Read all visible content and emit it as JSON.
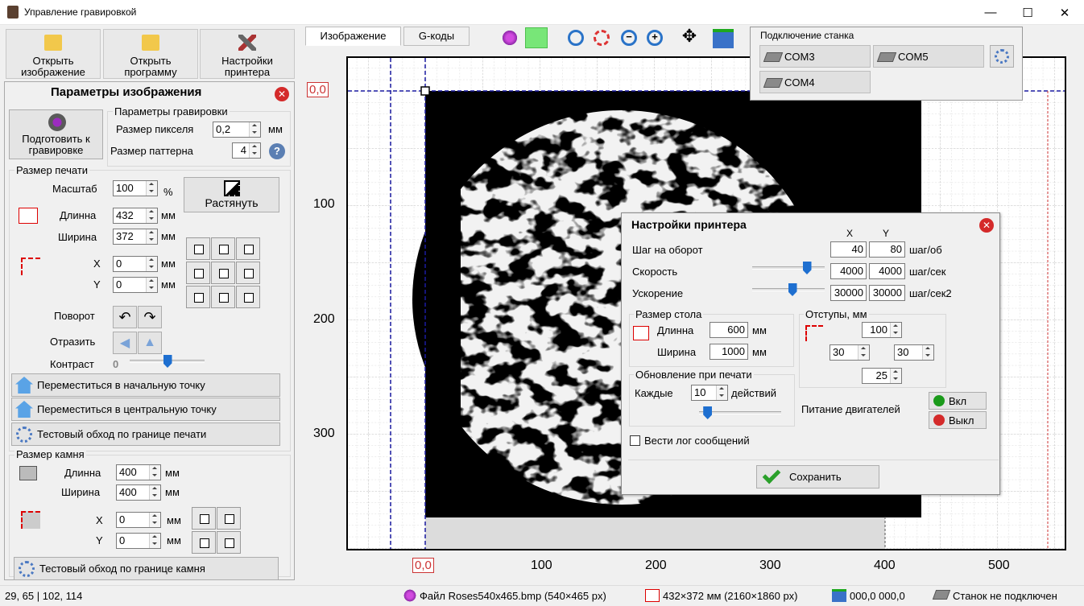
{
  "window": {
    "title": "Управление гравировкой",
    "minimize": "—",
    "maximize": "☐",
    "close": "✕"
  },
  "toolbar": {
    "open_image": [
      "Открыть",
      "изображение"
    ],
    "open_program": [
      "Открыть",
      "программу"
    ],
    "printer_settings": [
      "Настройки",
      "принтера"
    ]
  },
  "params": {
    "title": "Параметры изображения",
    "prepare": [
      "Подготовить к",
      "гравировке"
    ],
    "engrave_group": "Параметры гравировки",
    "pixel_size_label": "Размер пикселя",
    "pixel_size": "0,2",
    "mm": "мм",
    "pattern_size_label": "Размер паттерна",
    "pattern_size": "4",
    "print_size_group": "Размер печати",
    "scale_label": "Масштаб",
    "scale": "100",
    "percent": "%",
    "stretch": "Растянуть",
    "length_label": "Длинна",
    "length": "432",
    "width_label": "Ширина",
    "width": "372",
    "x_label": "X",
    "x": "0",
    "y_label": "Y",
    "y": "0",
    "rotate_label": "Поворот",
    "mirror_label": "Отразить",
    "contrast_label": "Контраст",
    "contrast_value": "0",
    "contrast_level": 0.5,
    "goto_start": "Переместиться в начальную точку",
    "goto_center": "Переместиться в центральную точку",
    "test_print_border": "Тестовый обход по границе печати",
    "stone_group": "Размер камня",
    "stone_length_label": "Длинна",
    "stone_length": "400",
    "stone_width_label": "Ширина",
    "stone_width": "400",
    "stone_x_label": "X",
    "stone_x": "0",
    "stone_y_label": "Y",
    "stone_y": "0",
    "test_stone_border": "Тестовый обход по границе камня"
  },
  "tabs": [
    {
      "label": "Изображение",
      "active": true
    },
    {
      "label": "G-коды",
      "active": false
    }
  ],
  "canvas": {
    "origin_top": "0,0",
    "origin_bottom": "0,0",
    "y_ticks": [
      "100",
      "200",
      "300"
    ],
    "x_ticks": [
      "100",
      "200",
      "300",
      "400",
      "500"
    ]
  },
  "connection": {
    "title": "Подключение станка",
    "ports": [
      "COM3",
      "COM5",
      "COM4"
    ]
  },
  "printer": {
    "title": "Настройки принтера",
    "col_x": "X",
    "col_y": "Y",
    "steps_label": "Шаг на оборот",
    "steps_x": "40",
    "steps_y": "80",
    "steps_unit": "шаг/об",
    "speed_label": "Скорость",
    "speed_x": "4000",
    "speed_y": "4000",
    "speed_unit": "шаг/сек",
    "speed_level": 0.75,
    "accel_label": "Ускорение",
    "accel_x": "30000",
    "accel_y": "30000",
    "accel_unit": "шаг/сек2",
    "accel_level": 0.55,
    "table_group": "Размер стола",
    "table_length_label": "Длинна",
    "table_length": "600",
    "table_width_label": "Ширина",
    "table_width": "1000",
    "mm": "мм",
    "margins_group": "Отступы, мм",
    "margin_top": "100",
    "margin_left": "30",
    "margin_right": "30",
    "margin_bottom": "25",
    "update_group": "Обновление при печати",
    "every_label": "Каждые",
    "every_value": "10",
    "actions_label": "действий",
    "update_level": 0.1,
    "motor_power_label": "Питание двигателей",
    "on_label": "Вкл",
    "off_label": "Выкл",
    "log_label": "Вести лог сообщений",
    "save_label": "Сохранить"
  },
  "status": {
    "coords": "29, 65  |  102, 114",
    "file": "Файл Roses540x465.bmp (540×465 px)",
    "size": "432×372 мм (2160×1860 px)",
    "position": "000,0  000,0",
    "machine": "Станок не подключен"
  },
  "colors": {
    "accent_blue": "#1e6fd0",
    "red": "#d42a2a",
    "green": "#1a9a1a"
  }
}
